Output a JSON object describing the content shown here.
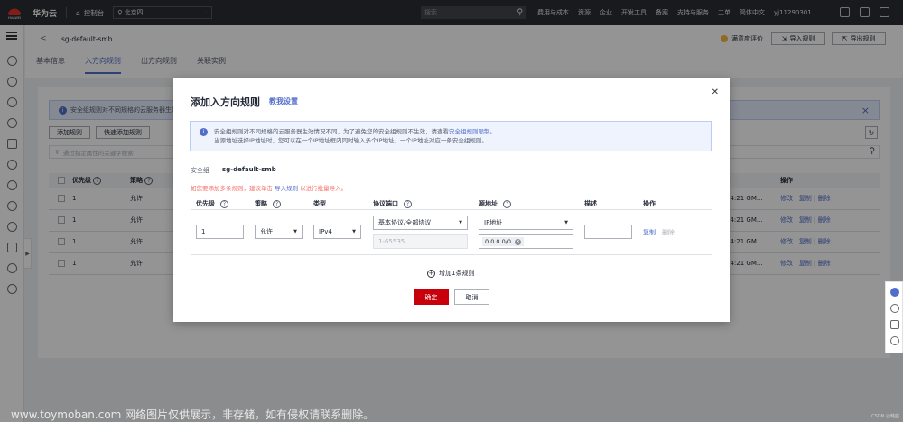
{
  "topbar": {
    "brand_small": "HUAWEI",
    "title": "华为云",
    "console": "控制台",
    "region": "北京四",
    "search_placeholder": "搜索",
    "links": [
      "费用与成本",
      "资源",
      "企业",
      "开发工具",
      "备案",
      "支持与服务",
      "工单",
      "简体中文",
      "yj11290301"
    ]
  },
  "header": {
    "back": "<",
    "sg_name": "sg-default-smb",
    "satisfaction": "满意度评价",
    "import_btn": "导入规则",
    "export_btn": "导出规则"
  },
  "tabs": [
    "基本信息",
    "入方向规则",
    "出方向规则",
    "关联实例"
  ],
  "content": {
    "info": "安全组规则对不同规格的云服务器生效",
    "buttons": [
      "添加规则",
      "快速添加规则"
    ],
    "filter_placeholder": "通过指定属性的关键字搜索",
    "columns": [
      "优先级",
      "策略",
      "操作"
    ],
    "rows": [
      {
        "priority": "1",
        "policy": "允许",
        "time": "04:21 GM...",
        "ops": [
          "修改",
          "复制",
          "删除"
        ]
      },
      {
        "priority": "1",
        "policy": "允许",
        "time": "04:21 GM...",
        "ops": [
          "修改",
          "复制",
          "删除"
        ]
      },
      {
        "priority": "1",
        "policy": "允许",
        "time": "04:21 GM...",
        "ops": [
          "修改",
          "复制",
          "删除"
        ]
      },
      {
        "priority": "1",
        "policy": "允许",
        "time": "04:21 GM...",
        "ops": [
          "修改",
          "复制",
          "删除"
        ]
      }
    ]
  },
  "dialog": {
    "title": "添加入方向规则",
    "tutorial": "教我设置",
    "info_line1_a": "安全组规则对不同规格的云服务器生效情况不同，为了避免您的安全组规则不生效，请查看",
    "info_line1_link": "安全组规则限制",
    "info_line1_b": "。",
    "info_line2": "当源地址选择IP地址时，您可以在一个IP地址框内同时输入多个IP地址，一个IP地址对应一条安全组规则。",
    "sg_label": "安全组",
    "sg_value": "sg-default-smb",
    "tip_a": "如您要添加多条规则，建议单击",
    "tip_link": "导入规则",
    "tip_b": "以进行批量导入。",
    "headers": [
      "优先级",
      "策略",
      "类型",
      "协议端口",
      "源地址",
      "描述",
      "操作"
    ],
    "row": {
      "priority": "1",
      "policy": "允许",
      "type": "IPv4",
      "protocol": "基本协议/全部协议",
      "port_placeholder": "1-65535",
      "source_type": "IP地址",
      "source_ip": "0.0.0.0/0",
      "op_copy": "复制",
      "op_delete": "删除"
    },
    "add_rule": "增加1条规则",
    "ok": "确定",
    "cancel": "取消"
  },
  "watermark": "www.toymoban.com 网络图片仅供展示，非存储，如有侵权请联系删除。",
  "csdn": "CSDN @韩盛"
}
